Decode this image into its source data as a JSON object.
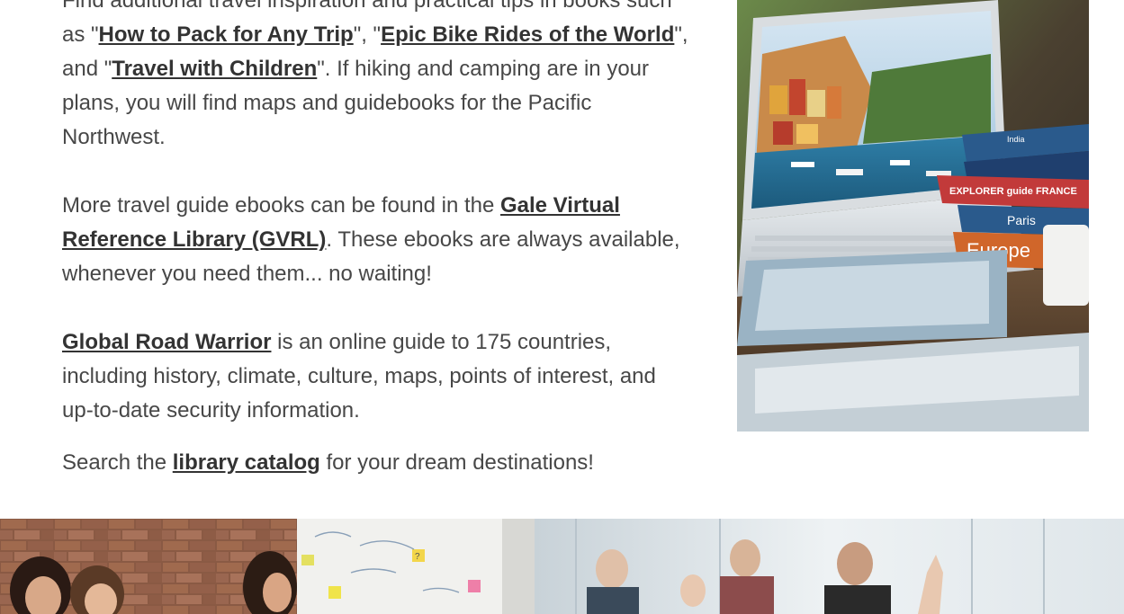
{
  "intro": {
    "line0": "Find additional travel inspiration and practical tips in books",
    "such_as": "such as \"",
    "link_pack": "How to Pack for Any Trip",
    "sep1": "\", \"",
    "link_bike": "Epic Bike Rides of the World",
    "sep2": "\", and \"",
    "link_children": "Travel with Children",
    "after": "\".  If hiking and camping are in your plans, you will find maps and guidebooks for the Pacific Northwest."
  },
  "gvrl": {
    "before": "More travel guide ebooks can be found in the ",
    "link": "Gale Virtual Reference Library (GVRL)",
    "after": ". These ebooks are always available, whenever you need them... no waiting!"
  },
  "road_warrior": {
    "link": "Global Road Warrior",
    "after": " is an online guide to 175 countries, including history, climate, culture, maps, points of interest, and up-to-date security information."
  },
  "catalog": {
    "before": "Search the ",
    "link": "library catalog",
    "after": " for your dream destinations!"
  },
  "photo": {
    "books": [
      "India",
      "EXPLORER guide FRANCE",
      "Paris",
      "Europe"
    ],
    "colors": {
      "book_blue": "#2a5a8c",
      "book_red": "#c23a3a",
      "book_orange": "#d0662a",
      "book_navy": "#1f3f6e"
    }
  },
  "banner": {
    "sticky_notes": [
      "?"
    ],
    "colors": {
      "brick": "#8a5a44",
      "office": "#dfe6ea"
    }
  }
}
